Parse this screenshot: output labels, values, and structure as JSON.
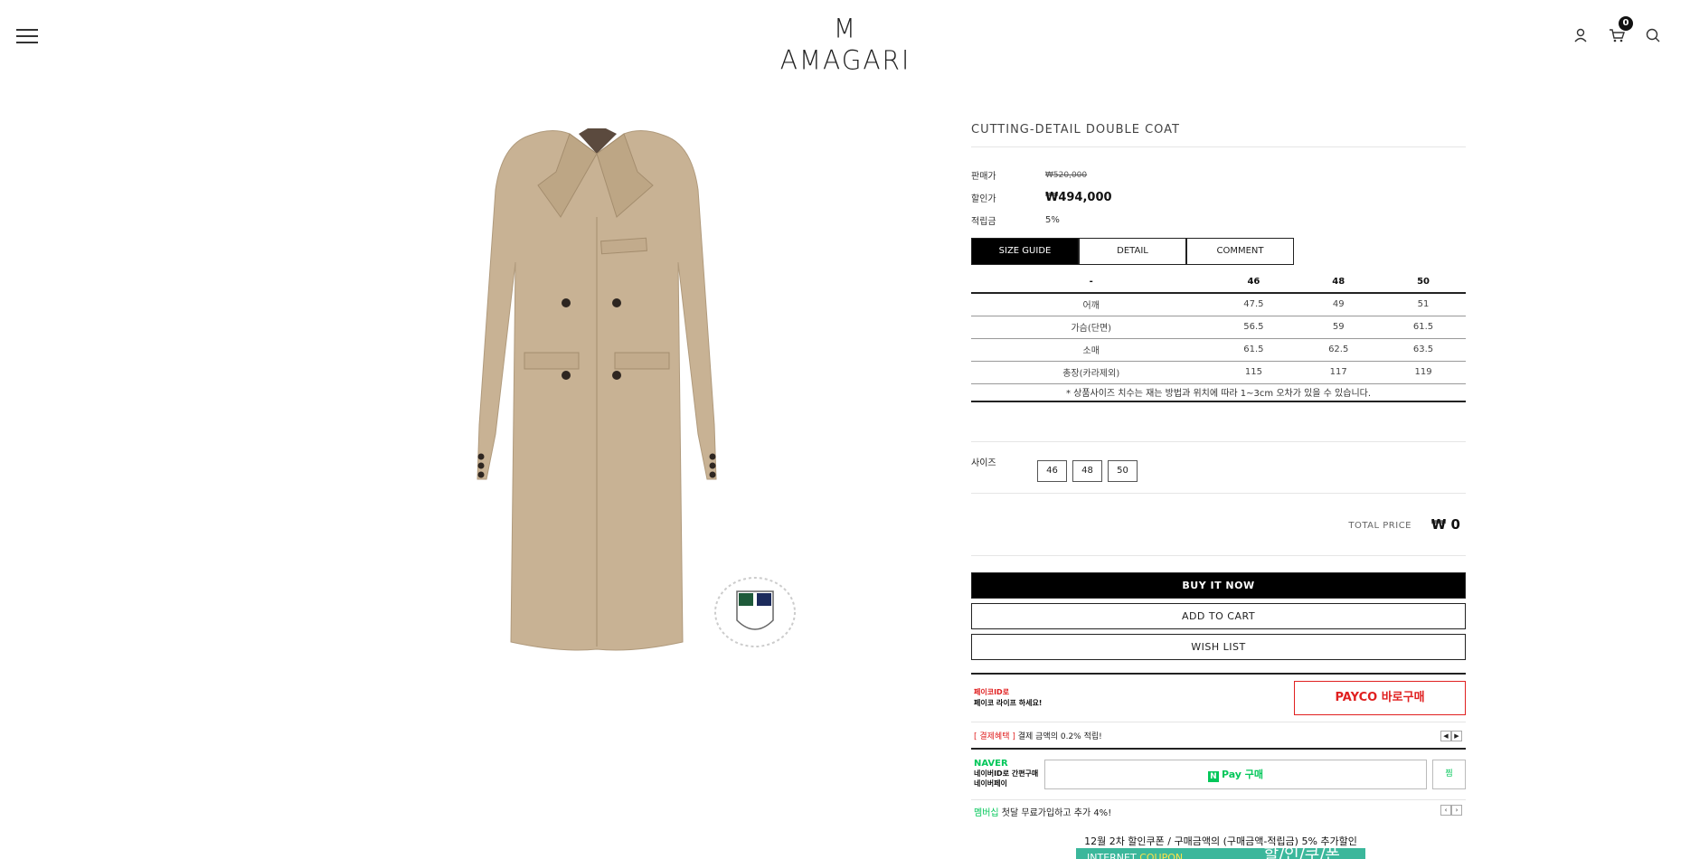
{
  "header": {
    "brand": "M AMAGARI",
    "cart_count": "0"
  },
  "product": {
    "name": "CUTTING-DETAIL DOUBLE COAT",
    "prices": [
      {
        "label": "판매가",
        "value": "₩520,000"
      },
      {
        "label": "할인가",
        "value": "₩494,000"
      },
      {
        "label": "적립금",
        "value": "5%"
      }
    ]
  },
  "tabs": [
    "SIZE GUIDE",
    "DETAIL",
    "COMMENT"
  ],
  "size_table": {
    "headers": [
      "-",
      "46",
      "48",
      "50"
    ],
    "rows": [
      [
        "어깨",
        "47.5",
        "49",
        "51"
      ],
      [
        "가슴(단면)",
        "56.5",
        "59",
        "61.5"
      ],
      [
        "소매",
        "61.5",
        "62.5",
        "63.5"
      ],
      [
        "총장(카라제외)",
        "115",
        "117",
        "119"
      ]
    ],
    "note": "* 상품사이즈 치수는 재는 방법과 위치에 따라 1~3cm 오차가 있을 수 있습니다."
  },
  "size_select": {
    "label": "사이즈",
    "options": [
      "46",
      "48",
      "50"
    ]
  },
  "total": {
    "label": "TOTAL PRICE",
    "value": "₩ 0"
  },
  "buttons": {
    "buy": "BUY IT NOW",
    "cart": "ADD TO CART",
    "wish": "WISH LIST"
  },
  "payco": {
    "line1": "페이코ID로",
    "line2": "페이코 라이프 하세요!",
    "button": "PAYCO 바로구매",
    "benefit_tag": "[ 결제혜택 ]",
    "benefit_text": " 결제 금액의 0.2% 적립!"
  },
  "naver": {
    "brand": "NAVER",
    "line1": "네이버ID로 간편구매",
    "line2": "네이버페이",
    "button_n": "N",
    "button": "Pay 구매",
    "zzim": "찜",
    "benefit_tag": "멤버십",
    "benefit_text": " 첫달 무료가입하고 추가 4%!"
  },
  "promo": {
    "text": "12월 2차 할인쿠폰 / 구매금액의 (구매금액-적립금) 5% 추가할인",
    "coupon_a": "INTERNET ",
    "coupon_b": "COUPON",
    "coupon_big": "할/인/쿠/폰"
  }
}
